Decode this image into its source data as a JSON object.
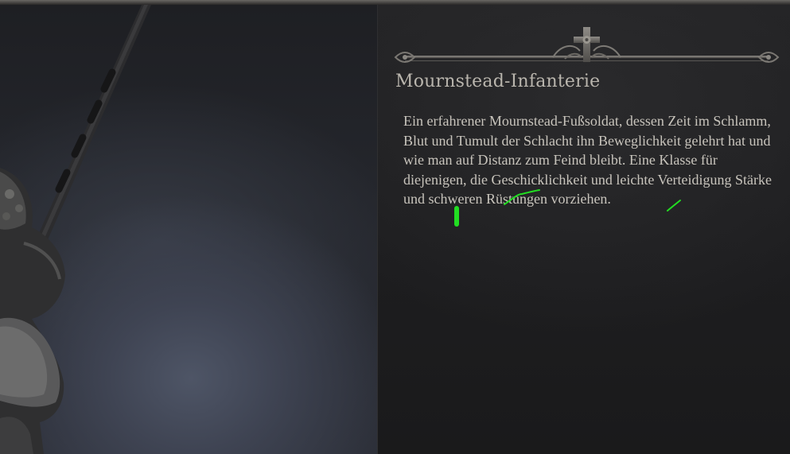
{
  "class_info": {
    "title": "Mournstead-Infanterie",
    "description": "Ein erfahrener Mournstead-Fußsoldat, dessen Zeit im Schlamm, Blut und Tumult der Schlacht ihn Beweglichkeit gelehrt hat und wie man auf Distanz zum Feind bleibt. Eine Klasse für diejenigen, die Geschicklichkeit und leichte Verteidigung Stärke und schweren Rüstungen vorziehen."
  },
  "colors": {
    "title_text": "#b9b5ad",
    "body_text": "#c8c4bc",
    "panel_background": "#1f1f21",
    "annotation_marks": "#22dd22"
  },
  "icons": {
    "ornament": "cross-filigree-ornament-icon"
  }
}
